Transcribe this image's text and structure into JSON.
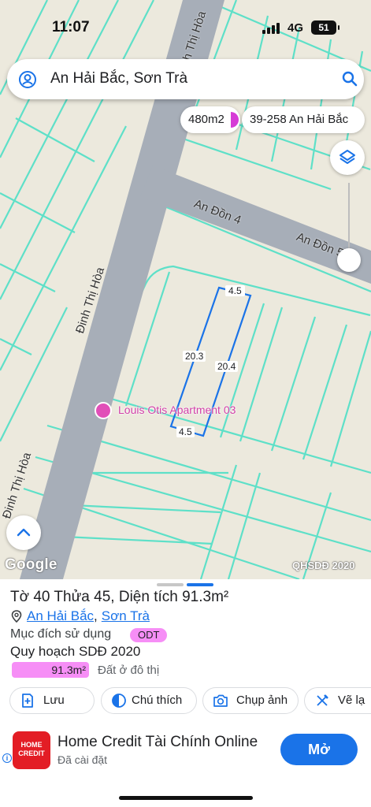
{
  "status_bar": {
    "time": "11:07",
    "network": "4G",
    "battery": "51"
  },
  "search": {
    "query": "An Hải Bắc, Sơn Trà"
  },
  "chips": {
    "area": "480m2",
    "address": "39-258 An Hải Bắc"
  },
  "map": {
    "roads": [
      "Đinh Thị Hòa",
      "Đinh Thị Hòa",
      "Đinh Thị Hòa",
      "An Đồn 4",
      "An Đồn 5"
    ],
    "plot_dims": {
      "top": "4.5",
      "bottom": "4.5",
      "left": "20.3",
      "right": "20.4"
    },
    "poi": "Louis Otis Apartment 03",
    "attribution": "Google",
    "overlay": "QHSDĐ 2020",
    "colors": {
      "land": "#ece9dd",
      "parcel_lines": "#5ee0c8",
      "road": "#a7aeb8",
      "plot_outline": "#1a73e8"
    }
  },
  "parcel": {
    "title": "Tờ 40 Thửa 45, Diện tích 91.3m²",
    "ward": "An Hải Bắc",
    "district": "Sơn Trà",
    "separator": ",",
    "purpose_label": "Mục đích sử dụng",
    "purpose_code": "ODT",
    "plan_label": "Quy hoạch SDĐ 2020",
    "plan_area": "91.3m²",
    "plan_use": "Đất ở đô thị"
  },
  "actions": [
    {
      "label": "Lưu",
      "icon": "save-icon"
    },
    {
      "label": "Chú thích",
      "icon": "contrast-icon"
    },
    {
      "label": "Chụp ảnh",
      "icon": "camera-icon"
    },
    {
      "label": "Vẽ lạ",
      "icon": "draw-icon"
    }
  ],
  "ad": {
    "logo_text": "HOME CREDIT",
    "title": "Home Credit Tài Chính Online",
    "subtitle": "Đã cài đặt",
    "button": "Mở",
    "brand_color": "#e31d25"
  }
}
